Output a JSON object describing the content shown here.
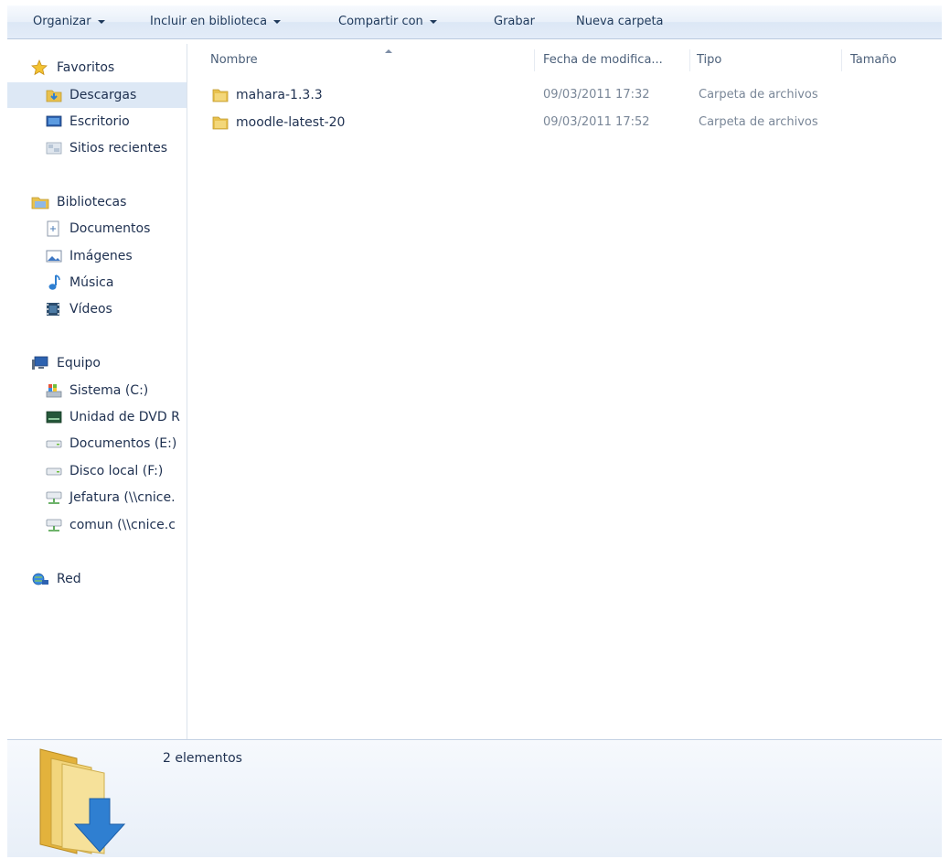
{
  "toolbar": {
    "organize": "Organizar",
    "include_library": "Incluir en biblioteca",
    "share_with": "Compartir con",
    "burn": "Grabar",
    "new_folder": "Nueva carpeta"
  },
  "nav": {
    "favorites": {
      "label": "Favoritos",
      "items": [
        "Descargas",
        "Escritorio",
        "Sitios recientes"
      ]
    },
    "libraries": {
      "label": "Bibliotecas",
      "items": [
        "Documentos",
        "Imágenes",
        "Música",
        "Vídeos"
      ]
    },
    "computer": {
      "label": "Equipo",
      "items": [
        "Sistema (C:)",
        "Unidad de DVD R",
        "Documentos (E:)",
        "Disco local (F:)",
        "Jefatura (\\\\cnice.",
        "comun (\\\\cnice.c"
      ]
    },
    "network": {
      "label": "Red"
    }
  },
  "columns": {
    "name": "Nombre",
    "date": "Fecha de modifica...",
    "type": "Tipo",
    "size": "Tamaño"
  },
  "files": [
    {
      "name": "mahara-1.3.3",
      "date": "09/03/2011 17:32",
      "type": "Carpeta de archivos"
    },
    {
      "name": "moodle-latest-20",
      "date": "09/03/2011 17:52",
      "type": "Carpeta de archivos"
    }
  ],
  "details": {
    "count": "2 elementos"
  },
  "icons": {
    "star": "star-icon",
    "folder": "folder-icon",
    "downloads": "downloads-folder-icon",
    "desktop": "desktop-icon",
    "recent": "recent-places-icon",
    "libraries": "libraries-icon",
    "documents": "documents-icon",
    "pictures": "pictures-icon",
    "music": "music-icon",
    "videos": "videos-icon",
    "computer": "computer-icon",
    "drive": "drive-icon",
    "network": "network-icon"
  },
  "colors": {
    "accent_text": "#1e395b",
    "selection": "#dde8f5",
    "folder_yellow": "#e8c14e",
    "arrow_blue": "#2f7fd1"
  }
}
